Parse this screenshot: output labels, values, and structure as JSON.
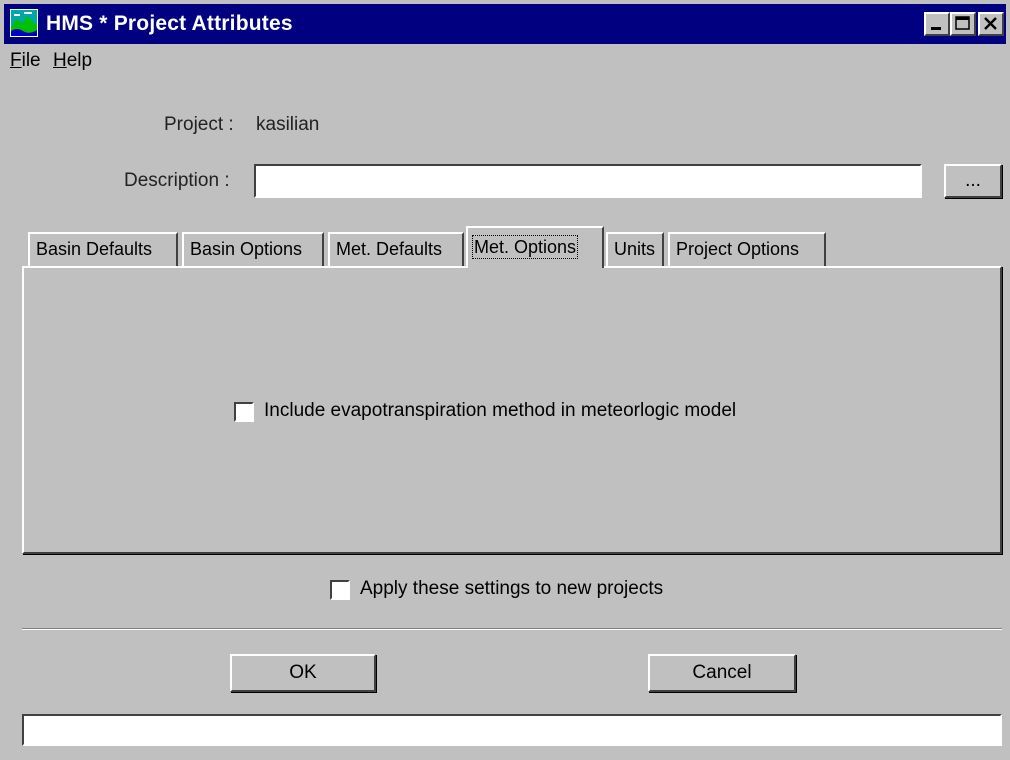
{
  "window": {
    "title": "HMS * Project Attributes",
    "title_bar_color": "#000080",
    "face_color": "#c0c0c0"
  },
  "menu": {
    "items": [
      {
        "label": "File",
        "mnemonic": "F"
      },
      {
        "label": "Help",
        "mnemonic": "H"
      }
    ]
  },
  "project": {
    "label": "Project :",
    "value": "kasilian"
  },
  "description": {
    "label": "Description :",
    "value": "",
    "browse_label": "..."
  },
  "tabs": {
    "items": [
      {
        "label": "Basin Defaults",
        "active": false
      },
      {
        "label": "Basin Options",
        "active": false
      },
      {
        "label": "Met. Defaults",
        "active": false
      },
      {
        "label": "Met. Options",
        "active": true
      },
      {
        "label": "Units",
        "active": false
      },
      {
        "label": "Project Options",
        "active": false
      }
    ]
  },
  "met_options": {
    "evapotranspiration_label": "Include evapotranspiration method in meteorlogic model",
    "evapotranspiration_checked": false
  },
  "apply_settings": {
    "label": "Apply these settings to new projects",
    "checked": false
  },
  "buttons": {
    "ok_label": "OK",
    "cancel_label": "Cancel"
  },
  "status": {
    "text": ""
  }
}
